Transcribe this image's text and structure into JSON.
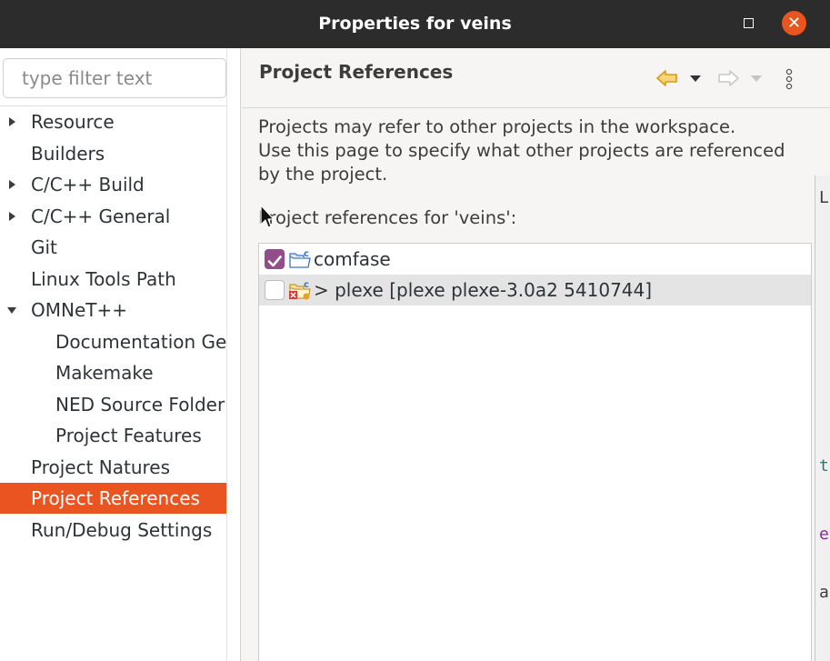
{
  "window": {
    "title": "Properties for veins",
    "maximize_icon": "maximize-icon",
    "close_icon": "close-icon",
    "close_symbol": "✕",
    "accent_color": "#e95420"
  },
  "sidebar": {
    "filter_placeholder": "type filter text",
    "items": [
      {
        "label": "Resource",
        "level": 0,
        "expander": "collapsed"
      },
      {
        "label": "Builders",
        "level": 0,
        "expander": "none"
      },
      {
        "label": "C/C++ Build",
        "level": 0,
        "expander": "collapsed"
      },
      {
        "label": "C/C++ General",
        "level": 0,
        "expander": "collapsed"
      },
      {
        "label": "Git",
        "level": 0,
        "expander": "none"
      },
      {
        "label": "Linux Tools Path",
        "level": 0,
        "expander": "none"
      },
      {
        "label": "OMNeT++",
        "level": 0,
        "expander": "expanded"
      },
      {
        "label": "Documentation Ge",
        "level": 1,
        "expander": "none"
      },
      {
        "label": "Makemake",
        "level": 1,
        "expander": "none"
      },
      {
        "label": "NED Source Folder",
        "level": 1,
        "expander": "none"
      },
      {
        "label": "Project Features",
        "level": 1,
        "expander": "none"
      },
      {
        "label": "Project Natures",
        "level": 0,
        "expander": "none"
      },
      {
        "label": "Project References",
        "level": 0,
        "expander": "none",
        "selected": true
      },
      {
        "label": "Run/Debug Settings",
        "level": 0,
        "expander": "none"
      }
    ]
  },
  "page": {
    "title": "Project References",
    "toolbar": {
      "back_icon": "back-arrow-icon",
      "back_menu_icon": "back-menu-dropdown-icon",
      "forward_icon": "forward-arrow-icon",
      "forward_menu_icon": "forward-menu-dropdown-icon",
      "menu_icon": "view-menu-icon"
    },
    "description_lines": [
      "Projects may refer to other projects in the workspace.",
      "Use this page to specify what other projects are referenced",
      "by the project."
    ],
    "references_label": "Project references for 'veins':",
    "references": [
      {
        "label": "comfase",
        "checked": true,
        "icon": "c-project-folder-icon"
      },
      {
        "label": "> plexe [plexe plexe-3.0a2 5410744]",
        "checked": false,
        "icon": "c-project-error-icon"
      }
    ]
  },
  "background_window": {
    "fragments": [
      "La",
      "ta",
      "e",
      "ar"
    ]
  }
}
